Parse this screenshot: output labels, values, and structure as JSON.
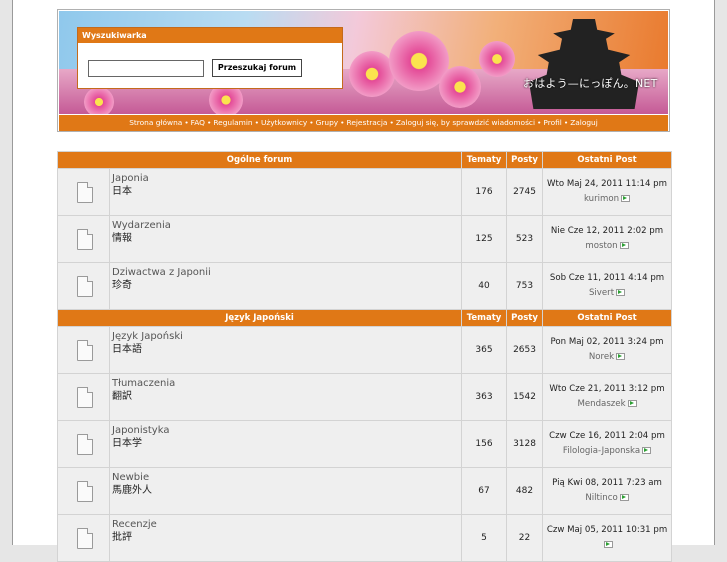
{
  "search": {
    "title": "Wyszukiwarka",
    "input_value": "",
    "button_label": "Przeszukaj forum"
  },
  "banner": {
    "site_name": "おはよう—にっぽん。NET"
  },
  "nav": {
    "items": [
      "Strona główna",
      "FAQ",
      "Regulamin",
      "Użytkownicy",
      "Grupy",
      "Rejestracja",
      "Zaloguj się, by sprawdzić wiadomości",
      "Profil",
      "Zaloguj"
    ]
  },
  "columns": {
    "topics": "Tematy",
    "posts": "Posty",
    "last_post": "Ostatni Post"
  },
  "categories": [
    {
      "name": "Ogólne forum",
      "forums": [
        {
          "name": "Japonia",
          "desc": "日本",
          "topics": "176",
          "posts": "2745",
          "last_date": "Wto Maj 24, 2011 11:14 pm",
          "last_user": "kurimon"
        },
        {
          "name": "Wydarzenia",
          "desc": "情報",
          "topics": "125",
          "posts": "523",
          "last_date": "Nie Cze 12, 2011 2:02 pm",
          "last_user": "moston"
        },
        {
          "name": "Dziwactwa z Japonii",
          "desc": "珍奇",
          "topics": "40",
          "posts": "753",
          "last_date": "Sob Cze 11, 2011 4:14 pm",
          "last_user": "Sivert"
        }
      ]
    },
    {
      "name": "Język Japoński",
      "forums": [
        {
          "name": "Język Japoński",
          "desc": "日本語",
          "topics": "365",
          "posts": "2653",
          "last_date": "Pon Maj 02, 2011 3:24 pm",
          "last_user": "Norek"
        },
        {
          "name": "Tłumaczenia",
          "desc": "翻訳",
          "topics": "363",
          "posts": "1542",
          "last_date": "Wto Cze 21, 2011 3:12 pm",
          "last_user": "Mendaszek"
        },
        {
          "name": "Japonistyka",
          "desc": "日本学",
          "topics": "156",
          "posts": "3128",
          "last_date": "Czw Cze 16, 2011 2:04 pm",
          "last_user": "Filologia-Japonska"
        },
        {
          "name": "Newbie",
          "desc": "馬鹿外人",
          "topics": "67",
          "posts": "482",
          "last_date": "Pią Kwi 08, 2011 7:23 am",
          "last_user": "Niltinco"
        },
        {
          "name": "Recenzje",
          "desc": "批評",
          "topics": "5",
          "posts": "22",
          "last_date": "Czw Maj 05, 2011 10:31 pm",
          "last_user": ""
        }
      ]
    }
  ]
}
